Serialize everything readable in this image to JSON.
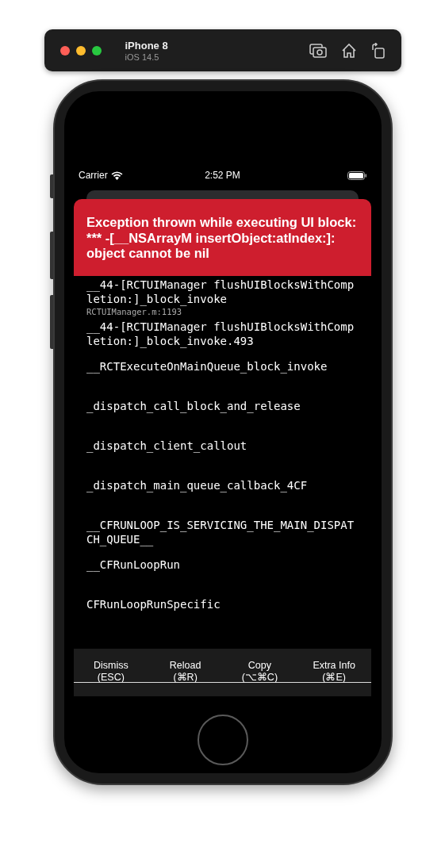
{
  "simulator": {
    "device": "iPhone 8",
    "os": "iOS 14.5"
  },
  "status_bar": {
    "carrier": "Carrier",
    "time": "2:52 PM"
  },
  "error": {
    "message": "Exception thrown while executing UI block: *** -[__NSArrayM insertObject:atIndex:]: object cannot be nil"
  },
  "stack": [
    {
      "method": "__44-[RCTUIManager flushUIBlocksWithCompletion:]_block_invoke",
      "file": "RCTUIManager.m:1193"
    },
    {
      "method": "__44-[RCTUIManager flushUIBlocksWithCompletion:]_block_invoke.493"
    },
    {
      "method": "__RCTExecuteOnMainQueue_block_invoke"
    },
    {
      "method": "_dispatch_call_block_and_release"
    },
    {
      "method": "_dispatch_client_callout"
    },
    {
      "method": "_dispatch_main_queue_callback_4CF"
    },
    {
      "method": "__CFRUNLOOP_IS_SERVICING_THE_MAIN_DISPATCH_QUEUE__"
    },
    {
      "method": "__CFRunLoopRun"
    },
    {
      "method": "CFRunLoopRunSpecific"
    }
  ],
  "buttons": [
    {
      "label": "Dismiss",
      "shortcut": "(ESC)"
    },
    {
      "label": "Reload",
      "shortcut": "(⌘R)"
    },
    {
      "label": "Copy",
      "shortcut": "(⌥⌘C)"
    },
    {
      "label": "Extra Info",
      "shortcut": "(⌘E)"
    }
  ]
}
